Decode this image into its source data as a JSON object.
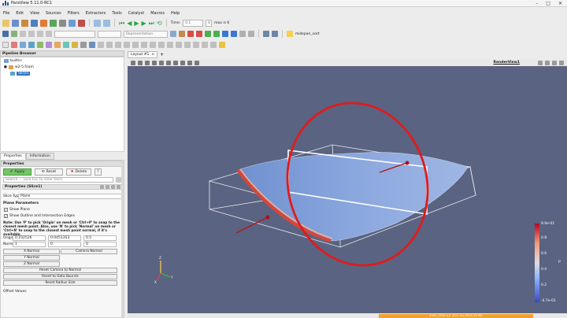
{
  "window": {
    "title": "ParaView 5.11.0-RC1"
  },
  "menu": [
    "File",
    "Edit",
    "View",
    "Sources",
    "Filters",
    "Extractors",
    "Tools",
    "Catalyst",
    "Macros",
    "Help"
  ],
  "toolbar": {
    "time_label": "Time:",
    "time_value": "0.1",
    "max_label": "max is 6",
    "representation": "Representation",
    "camera_name": "midspan_vort"
  },
  "pipeline_browser": {
    "title": "Pipeline Browser",
    "items": [
      "builtin:",
      "w2-5.foam",
      "Slice1"
    ]
  },
  "tabs": [
    "Properties",
    "Information"
  ],
  "properties": {
    "header": "Properties",
    "apply": "Apply",
    "reset": "Reset",
    "delete": "Delete",
    "help": "?",
    "search_placeholder": "Search ... (use Esc to clear text)",
    "section": "Properties (Slice1)",
    "slice_type_label": "Slice Type",
    "slice_type": "Plane",
    "plane_params": "Plane Parameters",
    "show_plane": "Show Plane",
    "show_outline": "Show Outline and Intersection Edges",
    "note": "Note: Use 'P' to pick 'Origin' on mesh or 'Ctrl+P' to snap to the closest mesh point. Also, use 'N' to pick 'Normal' on mesh or 'Ctrl+N' to snap to the closest mesh point normal, if it's available.",
    "origin_label": "Origin",
    "origin": [
      "0.102526",
      "0.0451353",
      "0.5"
    ],
    "normal_label": "Normal",
    "normal": [
      "1",
      "0",
      "0"
    ],
    "x_normal": "X Normal",
    "y_normal": "Y Normal",
    "z_normal": "Z Normal",
    "camera_normal": "Camera Normal",
    "reset_camera": "Reset Camera to Normal",
    "reset_bounds": "Reset to Data Bounds",
    "reset_radius": "Reset Radius Size",
    "offset_label": "Offset Values"
  },
  "layout": {
    "tab": "Layout #1",
    "close": "×",
    "add": "+"
  },
  "view": {
    "name": "RenderView1"
  },
  "colorbar": {
    "max": "9.9e-01",
    "ticks": [
      "0.8",
      "0.6",
      "0.4",
      "0.2"
    ],
    "min": "-4.7e-01",
    "title": "p"
  },
  "status": {
    "progress_text": "4402_1510 e-2, 6.27 ms (05.6-15.96)"
  },
  "colors": {
    "background": "#5a6381",
    "slice_ring": "#e01b1b",
    "wing": "#7d9ed8",
    "apply_green": "#75c766"
  }
}
